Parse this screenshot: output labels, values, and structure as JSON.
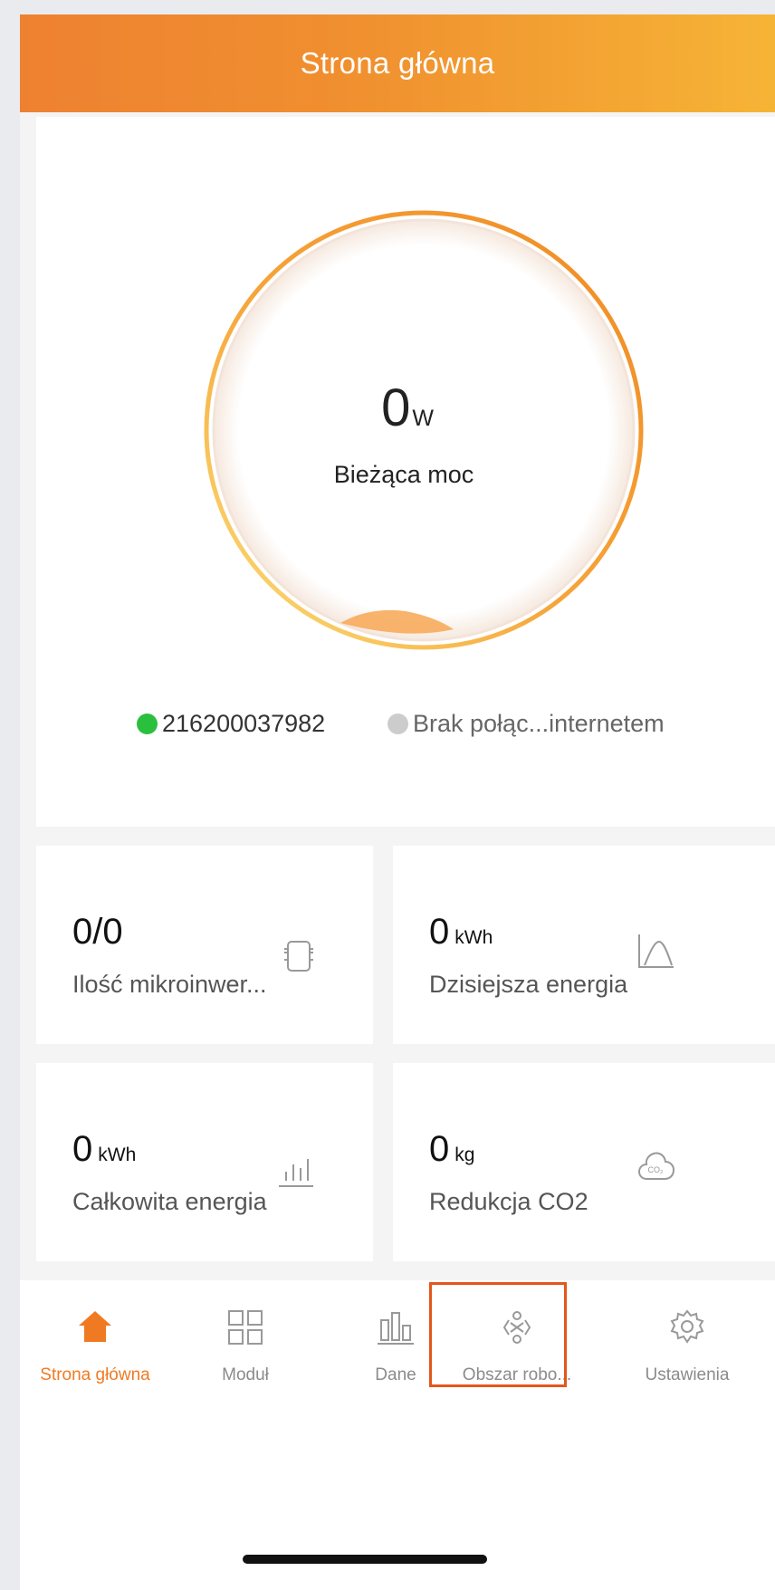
{
  "header": {
    "title": "Strona główna"
  },
  "hero": {
    "power_value": "0",
    "power_unit": "W",
    "power_label": "Bieżąca moc",
    "devices": [
      {
        "label": "216200037982",
        "color": "#2ac03e"
      },
      {
        "label": "Brak połąc...internetem",
        "color": "#cccccc"
      }
    ]
  },
  "stats": {
    "microinverters": {
      "value": "0/0",
      "unit": "",
      "label": "Ilość mikroinwer...",
      "icon": "microinverter-icon"
    },
    "today_energy": {
      "value": "0",
      "unit": "kWh",
      "label": "Dzisiejsza energia",
      "icon": "energy-curve-icon"
    },
    "total_energy": {
      "value": "0",
      "unit": "kWh",
      "label": "Całkowita energia",
      "icon": "bar-chart-icon"
    },
    "co2": {
      "value": "0",
      "unit": "kg",
      "label": "Redukcja CO2",
      "icon": "co2-cloud-icon"
    }
  },
  "tabs": [
    {
      "label": "Strona główna",
      "icon": "home-icon",
      "active": true
    },
    {
      "label": "Moduł",
      "icon": "grid-icon",
      "active": false
    },
    {
      "label": "Dane",
      "icon": "data-chart-icon",
      "active": false
    },
    {
      "label": "Obszar robo...",
      "icon": "work-area-icon",
      "active": false
    },
    {
      "label": "Ustawienia",
      "icon": "settings-icon",
      "active": false
    }
  ],
  "colors": {
    "accent": "#f07a22",
    "header_start": "#ee8131",
    "header_end": "#f6b436",
    "highlight": "#e3571b"
  }
}
